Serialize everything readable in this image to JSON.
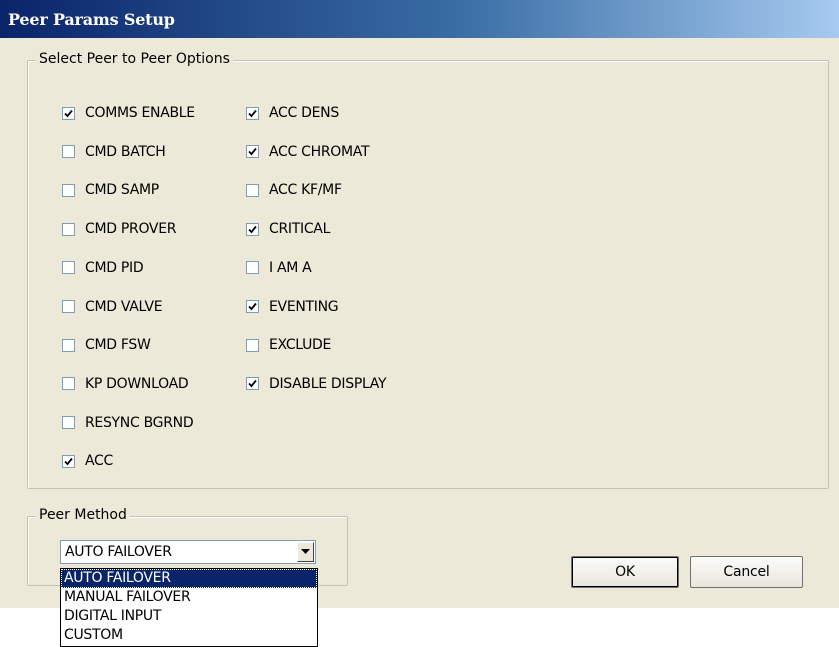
{
  "window": {
    "title": "Peer Params Setup"
  },
  "options_group": {
    "legend": "Select Peer to Peer Options",
    "left_column": [
      {
        "label": "COMMS ENABLE",
        "checked": true
      },
      {
        "label": "CMD BATCH",
        "checked": false
      },
      {
        "label": "CMD SAMP",
        "checked": false
      },
      {
        "label": "CMD PROVER",
        "checked": false
      },
      {
        "label": "CMD PID",
        "checked": false
      },
      {
        "label": "CMD VALVE",
        "checked": false
      },
      {
        "label": "CMD FSW",
        "checked": false
      },
      {
        "label": "KP DOWNLOAD",
        "checked": false
      },
      {
        "label": "RESYNC BGRND",
        "checked": false
      },
      {
        "label": "ACC",
        "checked": true
      }
    ],
    "right_column": [
      {
        "label": "ACC DENS",
        "checked": true
      },
      {
        "label": "ACC CHROMAT",
        "checked": true
      },
      {
        "label": "ACC KF/MF",
        "checked": false
      },
      {
        "label": "CRITICAL",
        "checked": true
      },
      {
        "label": "I AM A",
        "checked": false
      },
      {
        "label": "EVENTING",
        "checked": true
      },
      {
        "label": "EXCLUDE",
        "checked": false
      },
      {
        "label": "DISABLE DISPLAY",
        "checked": true
      }
    ]
  },
  "peer_method": {
    "legend": "Peer Method",
    "selected": "AUTO FAILOVER",
    "options": [
      "AUTO FAILOVER",
      "MANUAL FAILOVER",
      "DIGITAL INPUT",
      "CUSTOM"
    ],
    "highlighted_index": 0
  },
  "buttons": {
    "ok_label": "OK",
    "cancel_label": "Cancel"
  }
}
